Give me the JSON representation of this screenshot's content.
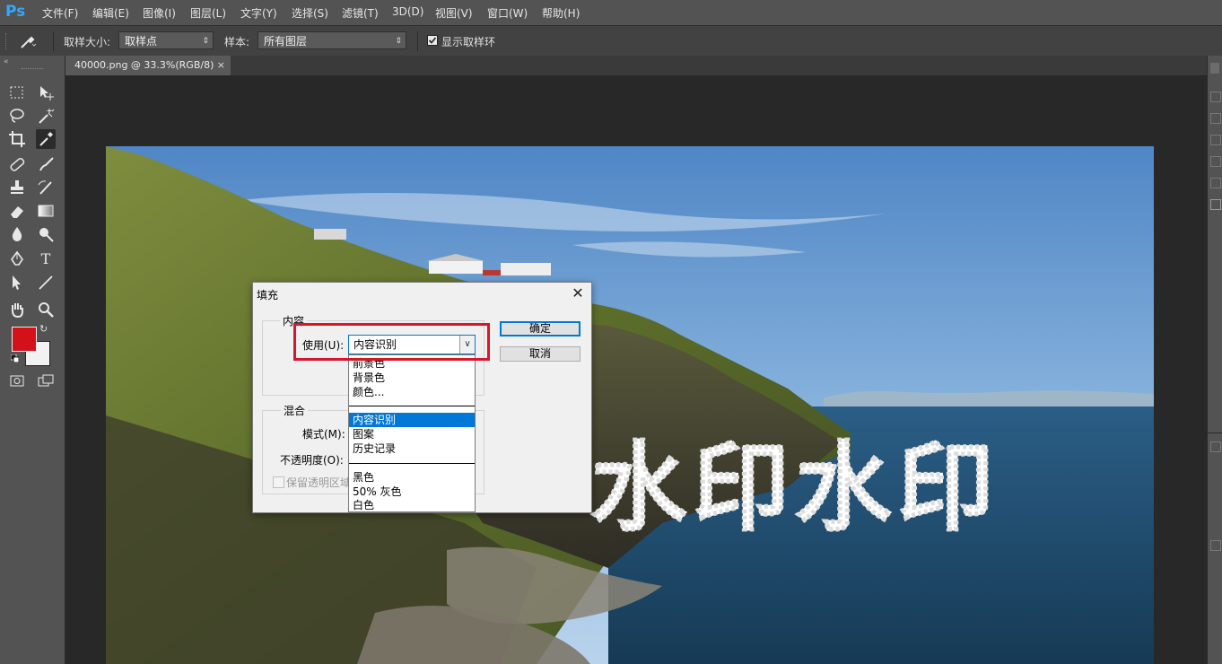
{
  "app": {
    "logo": "Ps",
    "accent": "#31a8ff"
  },
  "menu": [
    "文件(F)",
    "编辑(E)",
    "图像(I)",
    "图层(L)",
    "文字(Y)",
    "选择(S)",
    "滤镜(T)",
    "3D(D)",
    "视图(V)",
    "窗口(W)",
    "帮助(H)"
  ],
  "options_bar": {
    "tool_icon": "eyedropper-icon",
    "sample_size_label": "取样大小:",
    "sample_size_value": "取样点",
    "sample_label": "样本:",
    "sample_value": "所有图层",
    "show_ring_label": "显示取样环",
    "show_ring_checked": true
  },
  "document": {
    "tab_title": "40000.png @ 33.3%(RGB/8)",
    "close_glyph": "×"
  },
  "photo": {
    "watermark_text": "水印水印"
  },
  "toolbox": {
    "foreground_color": "#d4111b",
    "background_color": "#f2f2f2",
    "tools": [
      [
        "rect-marquee-icon",
        "move-icon"
      ],
      [
        "lasso-icon",
        "magic-wand-icon"
      ],
      [
        "crop-icon",
        "eyedropper-icon"
      ],
      [
        "healing-brush-icon",
        "brush-icon"
      ],
      [
        "clone-stamp-icon",
        "history-brush-icon"
      ],
      [
        "eraser-icon",
        "gradient-icon"
      ],
      [
        "blur-icon",
        "dodge-icon"
      ],
      [
        "pen-icon",
        "type-icon"
      ],
      [
        "path-select-icon",
        "line-icon"
      ],
      [
        "hand-icon",
        "zoom-icon"
      ]
    ]
  },
  "dialog": {
    "title": "填充",
    "close_glyph": "✕",
    "content_group": "内容",
    "use_label": "使用(U):",
    "use_value": "内容识别",
    "blend_group": "混合",
    "mode_label": "模式(M):",
    "opacity_label": "不透明度(O):",
    "preserve_label": "保留透明区域",
    "ok_label": "确定",
    "cancel_label": "取消",
    "dropdown_options": [
      "前景色",
      "背景色",
      "颜色...",
      "内容识别",
      "图案",
      "历史记录",
      "黑色",
      "50% 灰色",
      "白色"
    ],
    "selected_option": "内容识别"
  },
  "annotation": {
    "color": "#d4172a"
  }
}
